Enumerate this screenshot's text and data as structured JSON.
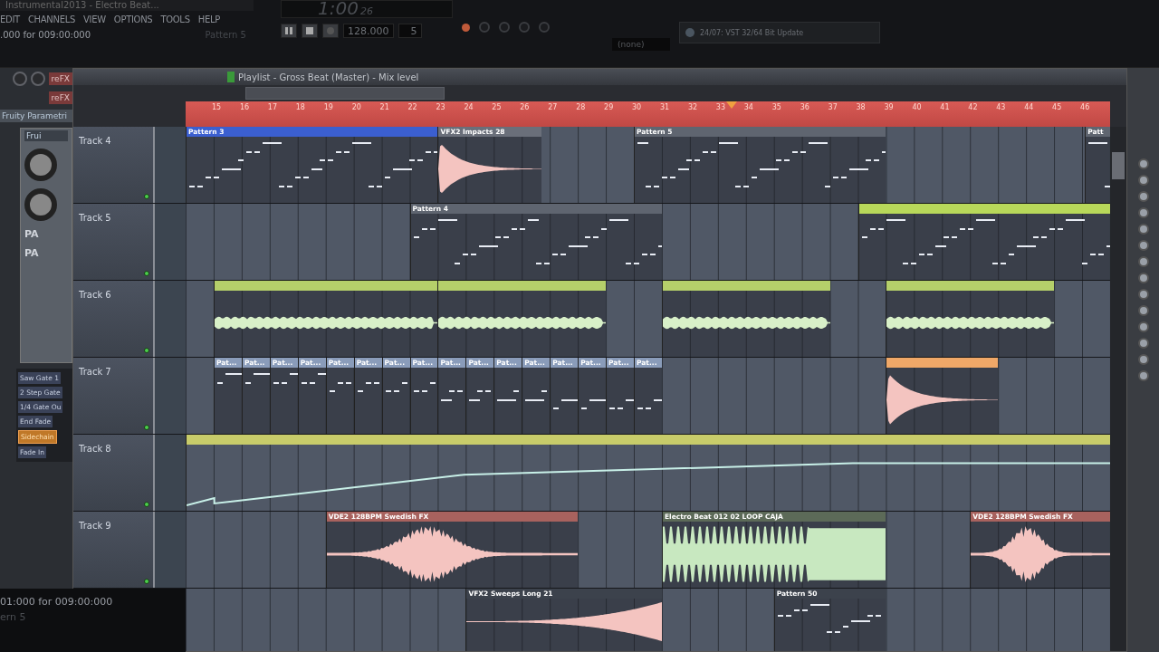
{
  "top_bar": {
    "title": "Instrumental2013 - Electro Beat...",
    "menu": [
      "EDIT",
      "CHANNELS",
      "VIEW",
      "OPTIONS",
      "TOOLS",
      "HELP"
    ],
    "hint": ".000 for 009:00:000",
    "pattern_label": "Pattern 5",
    "time": "1:00",
    "time_small": "26",
    "tempo": "128.000",
    "pattern_number": "5",
    "preset": "(none)",
    "news": "24/07: VST 32/64 Bit Update"
  },
  "left_panel": {
    "plugin_buttons": [
      "reFX",
      "reFX"
    ],
    "plugin_title": "Fruity Parametri",
    "sub_title": "Frui",
    "panel_labels": [
      "PA",
      "PA"
    ],
    "presets": [
      {
        "label": "Saw Gate 1",
        "selected": false
      },
      {
        "label": "2 Step Gate",
        "selected": false
      },
      {
        "label": "1/4 Gate Ou",
        "selected": false
      },
      {
        "label": "End Fade",
        "selected": false
      },
      {
        "label": "Sidechain",
        "selected": true
      },
      {
        "label": "Fade In",
        "selected": false
      }
    ]
  },
  "hint_panel": {
    "line_1": "01:000 for 009:00:000",
    "line_2": "ern 5"
  },
  "playlist": {
    "title": "Playlist - Gross Beat (Master) - Mix level",
    "bars": [
      "15",
      "16",
      "17",
      "18",
      "19",
      "20",
      "21",
      "22",
      "23",
      "24",
      "25",
      "26",
      "27",
      "28",
      "29",
      "30",
      "31",
      "32",
      "33",
      "34",
      "35",
      "36",
      "37",
      "38",
      "39",
      "40",
      "41",
      "42",
      "43",
      "44",
      "45",
      "46"
    ],
    "tracks": [
      {
        "name": "Track 4",
        "clips": [
          {
            "name": "Pattern 3",
            "kind": "pattern",
            "color": "#3b5fd0"
          },
          {
            "name": "VFX2 Impacts 28",
            "kind": "audio",
            "color": "#6a6f7a"
          },
          {
            "name": "Pattern 5",
            "kind": "pattern",
            "color": "#5f6570"
          },
          {
            "name": "Patt",
            "kind": "pattern",
            "color": "#5f6570"
          }
        ]
      },
      {
        "name": "Track 5",
        "clips": [
          {
            "name": "Pattern 4",
            "kind": "pattern",
            "color": "#5f6570"
          },
          {
            "kind": "pattern",
            "color": "#b8d85a"
          }
        ]
      },
      {
        "name": "Track 6",
        "clips": [
          {
            "kind": "audio",
            "color": "#b5cf6a"
          },
          {
            "kind": "audio",
            "color": "#b5cf6a"
          },
          {
            "kind": "audio",
            "color": "#b5cf6a"
          },
          {
            "kind": "audio",
            "color": "#b5cf6a"
          }
        ]
      },
      {
        "name": "Track 7",
        "clips": [
          {
            "name": "Pat...",
            "kind": "pattern",
            "color": "#8a9cba"
          },
          {
            "name": "Pat...",
            "kind": "pattern",
            "color": "#8a9cba"
          },
          {
            "name": "Pat...",
            "kind": "pattern",
            "color": "#8a9cba"
          },
          {
            "name": "Pat...",
            "kind": "pattern",
            "color": "#8a9cba"
          },
          {
            "name": "Pat...",
            "kind": "pattern",
            "color": "#8a9cba"
          },
          {
            "name": "Pat...",
            "kind": "pattern",
            "color": "#8a9cba"
          },
          {
            "name": "Pat...",
            "kind": "pattern",
            "color": "#8a9cba"
          },
          {
            "name": "Pat...",
            "kind": "pattern",
            "color": "#8a9cba"
          },
          {
            "name": "Pat...",
            "kind": "pattern",
            "color": "#8a9cba"
          },
          {
            "name": "Pat...",
            "kind": "pattern",
            "color": "#8a9cba"
          },
          {
            "name": "Pat...",
            "kind": "pattern",
            "color": "#8a9cba"
          },
          {
            "name": "Pat...",
            "kind": "pattern",
            "color": "#8a9cba"
          },
          {
            "name": "Pat...",
            "kind": "pattern",
            "color": "#8a9cba"
          },
          {
            "name": "Pat...",
            "kind": "pattern",
            "color": "#8a9cba"
          },
          {
            "name": "Pat...",
            "kind": "pattern",
            "color": "#8a9cba"
          },
          {
            "name": "Pat...",
            "kind": "pattern",
            "color": "#8a9cba"
          },
          {
            "kind": "audio",
            "color": "#f0a868"
          }
        ]
      },
      {
        "name": "Track 8",
        "clips": [
          {
            "kind": "automation",
            "color": "#c8cc6a"
          }
        ]
      },
      {
        "name": "Track 9",
        "clips": [
          {
            "name": "VDE2 128BPM Swedish FX",
            "kind": "audio",
            "color": "#a8625e"
          },
          {
            "name": "Electro Beat 012 02 LOOP CAJA",
            "kind": "audio",
            "color": "#5c6a58"
          },
          {
            "name": "VDE2 128BPM Swedish FX",
            "kind": "audio",
            "color": "#a8625e"
          }
        ]
      },
      {
        "clips": [
          {
            "name": "VFX2 Sweeps Long 21",
            "kind": "audio",
            "color": "#3c424c"
          },
          {
            "name": "Pattern 50",
            "kind": "pattern",
            "color": "#3c424c"
          }
        ]
      }
    ]
  }
}
